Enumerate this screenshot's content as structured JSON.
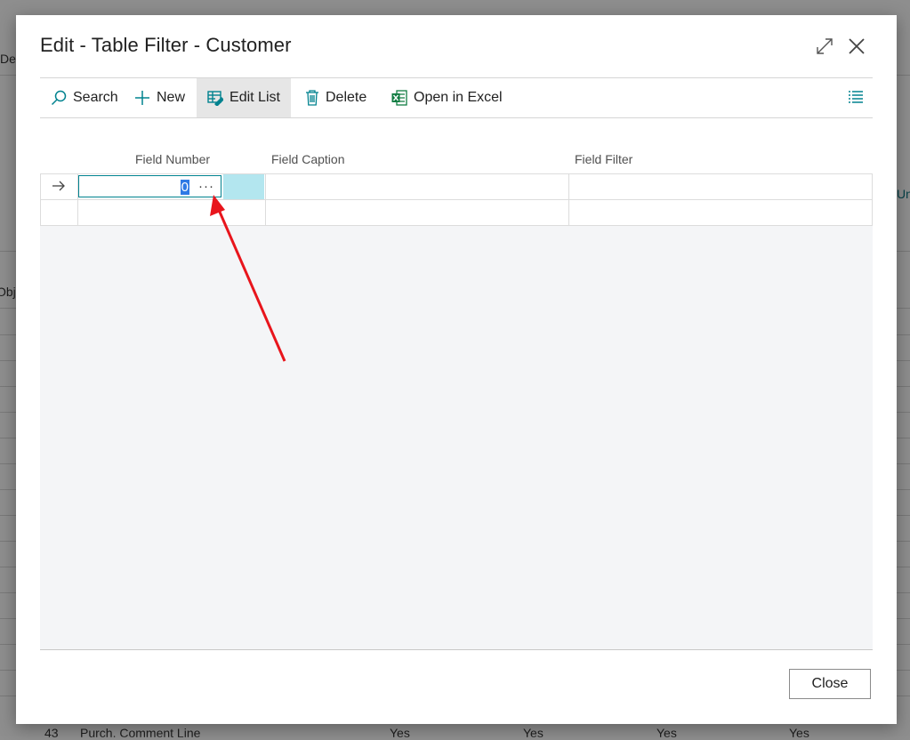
{
  "background": {
    "labels": [
      "Del",
      "Obj",
      "Un",
      "43",
      "Purch. Comment Line",
      "Yes",
      "Yes",
      "Yes",
      "Yes"
    ]
  },
  "dialog": {
    "title": "Edit - Table Filter - Customer",
    "expand_icon": "expand-icon",
    "close_icon": "close-icon"
  },
  "toolbar": {
    "search": "Search",
    "new": "New",
    "edit_list": "Edit List",
    "delete": "Delete",
    "open_in_excel": "Open in Excel",
    "list_view_icon": "list-view-icon"
  },
  "grid": {
    "columns": [
      "Field Number",
      "Field Caption",
      "Field Filter"
    ],
    "rows": [
      {
        "field_number": "0",
        "field_caption": "",
        "field_filter": ""
      },
      {
        "field_number": "",
        "field_caption": "",
        "field_filter": ""
      }
    ],
    "lookup_label": "···"
  },
  "footer": {
    "close_label": "Close"
  },
  "colors": {
    "accent": "#00828f",
    "selection": "#b3e6ef",
    "annotation": "#e8151c"
  }
}
